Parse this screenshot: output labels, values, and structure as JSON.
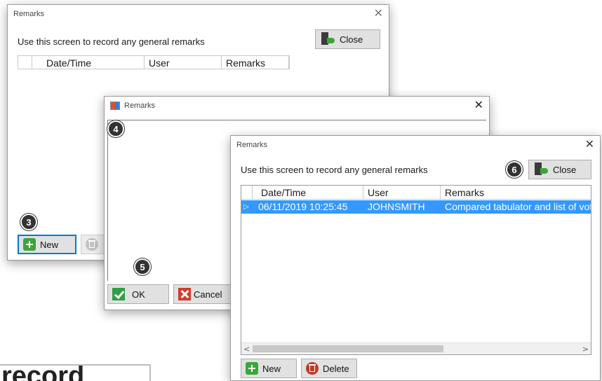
{
  "background_text": "record",
  "window1": {
    "title": "Remarks",
    "description": "Use this screen to record any general remarks",
    "close_label": "Close",
    "columns": [
      "Date/Time",
      "User",
      "Remarks"
    ],
    "new_label": "New",
    "step": "3"
  },
  "window2": {
    "title": "Remarks",
    "ok_label": "OK",
    "cancel_label": "Cancel",
    "step_input": "4",
    "step_ok": "5"
  },
  "window3": {
    "title": "Remarks",
    "description": "Use this screen to record any general remarks",
    "close_label": "Close",
    "step_close": "6",
    "columns": [
      "Date/Time",
      "User",
      "Remarks"
    ],
    "rows": [
      {
        "datetime": "06/11/2019 10:25:45",
        "user": "JOHNSMITH",
        "remarks": "Compared tabulator and list of vote"
      }
    ],
    "new_label": "New",
    "delete_label": "Delete"
  },
  "colors": {
    "selection": "#3399ff",
    "focus_border": "#0078d7",
    "badge": "#333333"
  }
}
